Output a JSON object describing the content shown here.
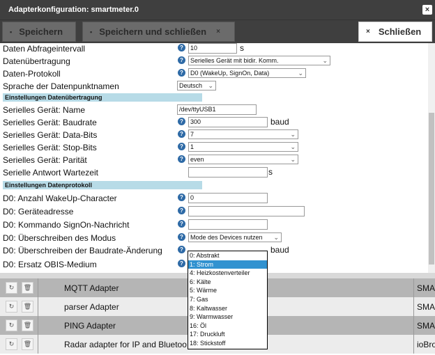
{
  "window": {
    "title": "Adapterkonfiguration: smartmeter.0",
    "close_glyph": "×"
  },
  "toolbar": {
    "save_label": "Speichern",
    "save_close_label": "Speichern und schließen",
    "close_label": "Schließen",
    "save_icon": "floppy-icon",
    "x_glyph": "×",
    "floppy_glyph": "▪"
  },
  "form": {
    "rows": [
      {
        "label": "Daten Abfrageintervall",
        "value": "10",
        "unit": "s"
      },
      {
        "label": "Datenübertragung",
        "value": "Serielles Gerät mit bidir. Komm."
      },
      {
        "label": "Daten-Protokoll",
        "value": "D0 (WakeUp, SignOn, Data)"
      },
      {
        "label": "Sprache der Datenpunktnamen",
        "value": "Deutsch"
      },
      {
        "section": "Einstellungen Datenübertragung"
      },
      {
        "label": "Serielles Gerät: Name",
        "value": "/dev/ttyUSB1"
      },
      {
        "label": "Serielles Gerät: Baudrate",
        "value": "300",
        "unit": "baud"
      },
      {
        "label": "Serielles Gerät: Data-Bits",
        "value": "7"
      },
      {
        "label": "Serielles Gerät: Stop-Bits",
        "value": "1"
      },
      {
        "label": "Serielles Gerät: Parität",
        "value": "even"
      },
      {
        "label": "Serielle Antwort Wartezeit",
        "value": "",
        "unit": "s"
      },
      {
        "section": "Einstellungen Datenprotokoll"
      },
      {
        "label": "D0: Anzahl WakeUp-Character",
        "value": "0"
      },
      {
        "label": "D0: Geräteadresse",
        "value": ""
      },
      {
        "label": "D0: Kommando SignOn-Nachricht",
        "value": ""
      },
      {
        "label": "D0: Überschreiben des Modus",
        "value": "Mode des Devices nutzen"
      },
      {
        "label": "D0: Überschreiben der Baudrate-Änderung",
        "unit": "baud"
      },
      {
        "label": "D0: Ersatz OBIS-Medium"
      }
    ],
    "help_glyph": "?",
    "chevron_glyph": "⌄"
  },
  "dropdown": {
    "options": [
      "0: Abstrakt",
      "1: Strom",
      "4: Heizkostenverteiler",
      "6: Kälte",
      "5: Wärme",
      "7: Gas",
      "8: Kaltwasser",
      "9: Warmwasser",
      "16: Öl",
      "17: Druckluft",
      "18: Stickstoff"
    ],
    "selected": "1: Strom"
  },
  "adapters": [
    {
      "name": "MQTT Adapter",
      "right": "SMA"
    },
    {
      "name": "parser Adapter",
      "right": "SMA"
    },
    {
      "name": "PING Adapter",
      "right": "SMA"
    },
    {
      "name": "Radar adapter for IP and Bluetoo",
      "right": "ioBro"
    }
  ],
  "list_icons": {
    "refresh_glyph": "↻",
    "delete_glyph": "🗑"
  }
}
